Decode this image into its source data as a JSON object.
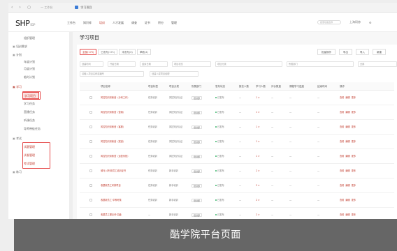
{
  "browser": {
    "address": "— 工作台",
    "tab_label": "学习项目"
  },
  "logo": {
    "text": "SHP",
    "sub": "EDP"
  },
  "topnav": {
    "items": [
      "工作台",
      "知识库",
      "培训",
      "人才发展",
      "调查",
      "证书",
      "积分",
      "管理"
    ],
    "search_placeholder": "搜索功能名称",
    "user": "上海研修",
    "settings_icon": "gear-icon"
  },
  "sidebar": {
    "items": [
      {
        "label": "组织管理",
        "level": 2
      },
      {
        "label": "培训需求",
        "level": 1
      },
      {
        "label": "计划",
        "level": 1
      },
      {
        "label": "年度计划",
        "level": 2
      },
      {
        "label": "月度计划",
        "level": 2
      },
      {
        "label": "临时计划",
        "level": 2
      },
      {
        "label": "学习",
        "level": 1,
        "red": true
      },
      {
        "label": "学习项目",
        "level": 2,
        "selected": true
      },
      {
        "label": "学习任务",
        "level": 2
      },
      {
        "label": "直播任务",
        "level": 2
      },
      {
        "label": "听课任务",
        "level": 2
      },
      {
        "label": "导师带徒任务",
        "level": 2
      },
      {
        "label": "考试",
        "level": 1
      },
      {
        "label": "试题管理",
        "level": 2,
        "red": true
      },
      {
        "label": "试卷管理",
        "level": 2,
        "red": true
      },
      {
        "label": "考试管理",
        "level": 2,
        "red": true
      },
      {
        "label": "练习",
        "level": 1
      }
    ]
  },
  "main": {
    "title": "学习项目",
    "chips": [
      "全部(175)",
      "已发布(171)",
      "未发布(0)",
      "草稿(4)"
    ],
    "right_buttons": [
      "批量操作",
      "导出",
      "导入",
      "新建"
    ],
    "filters": [
      "创建时间",
      "开始日期",
      "结束日期",
      "项目状态",
      "项目分类",
      "所属部门",
      "全部"
    ],
    "filters2": [
      "请输入项目名称或编号",
      "创建人或项目经理"
    ],
    "columns": [
      "项目名称",
      "项目标签",
      "项目分类",
      "所属部门",
      "发布状态",
      "报名人数",
      "学习人数",
      "评价数量",
      "课程学习进度",
      "结束时间",
      "操作"
    ],
    "rows": [
      {
        "name": "风控知识训练营（分科工作）",
        "tag": "任务培训",
        "category": "风控知识认证",
        "dept": "培训部",
        "status": "已发布",
        "enroll": "—",
        "learners": "1 >",
        "reviews": "—",
        "progress": "—",
        "end": "—",
        "actions": [
          "查看",
          "编辑",
          "更多"
        ]
      },
      {
        "name": "风控知识训练营（营销）",
        "tag": "任务培训",
        "category": "风控知识认证",
        "dept": "培训部",
        "status": "已发布",
        "enroll": "—",
        "learners": "1 >",
        "reviews": "—",
        "progress": "—",
        "end": "—",
        "actions": [
          "查看",
          "编辑",
          "更多"
        ]
      },
      {
        "name": "风控知识训练营（客服）",
        "tag": "任务培训",
        "category": "风控知识认证",
        "dept": "培训部",
        "status": "已发布",
        "enroll": "—",
        "learners": "1 >",
        "reviews": "—",
        "progress": "—",
        "end": "—",
        "actions": [
          "查看",
          "编辑",
          "更多"
        ]
      },
      {
        "name": "风控知识训练营（渠道）",
        "tag": "任务培训",
        "category": "风控知识认证",
        "dept": "培训部",
        "status": "已发布",
        "enroll": "—",
        "learners": "1 >",
        "reviews": "—",
        "progress": "—",
        "end": "—",
        "actions": [
          "查看",
          "编辑",
          "更多"
        ]
      },
      {
        "name": "风控知识训练营（运营系统）",
        "tag": "任务培训",
        "category": "风控知识认证",
        "dept": "培训部",
        "status": "已发布",
        "enroll": "—",
        "learners": "1 >",
        "reviews": "—",
        "progress": "—",
        "end": "—",
        "actions": [
          "查看",
          "编辑",
          "更多"
        ]
      },
      {
        "name": "骑马入职·新员工培训证书",
        "tag": "任务培训",
        "category": "新手培训",
        "dept": "培训部",
        "status": "已发布",
        "enroll": "—",
        "learners": "2 >",
        "reviews": "—",
        "progress": "—",
        "end": "—",
        "actions": [
          "查看",
          "编辑",
          "更多"
        ]
      },
      {
        "name": "收银新员工考核项目",
        "tag": "任务培训",
        "category": "新手培训",
        "dept": "培训部",
        "status": "已发布",
        "enroll": "—",
        "learners": "2 >",
        "reviews": "—",
        "progress": "—",
        "end": "—",
        "actions": [
          "查看",
          "编辑",
          "更多"
        ]
      },
      {
        "name": "收银新员工·中等考核",
        "tag": "任务培训",
        "category": "新手培训",
        "dept": "培训部",
        "status": "已发布",
        "enroll": "—",
        "learners": "2 >",
        "reviews": "—",
        "progress": "—",
        "end": "—",
        "actions": [
          "查看",
          "编辑",
          "更多"
        ]
      },
      {
        "name": "收银员工理论考·四级",
        "tag": "—",
        "category": "新手培训",
        "dept": "培训部",
        "status": "已发布",
        "enroll": "—",
        "learners": "2 >",
        "reviews": "—",
        "progress": "—",
        "end": "—",
        "actions": [
          "查看",
          "编辑",
          "更多"
        ]
      }
    ]
  },
  "caption": "酷学院平台页面",
  "colors": {
    "accent": "#e54b4b",
    "accent_text": "#c0392b",
    "status_dot": "#3bb56b"
  }
}
